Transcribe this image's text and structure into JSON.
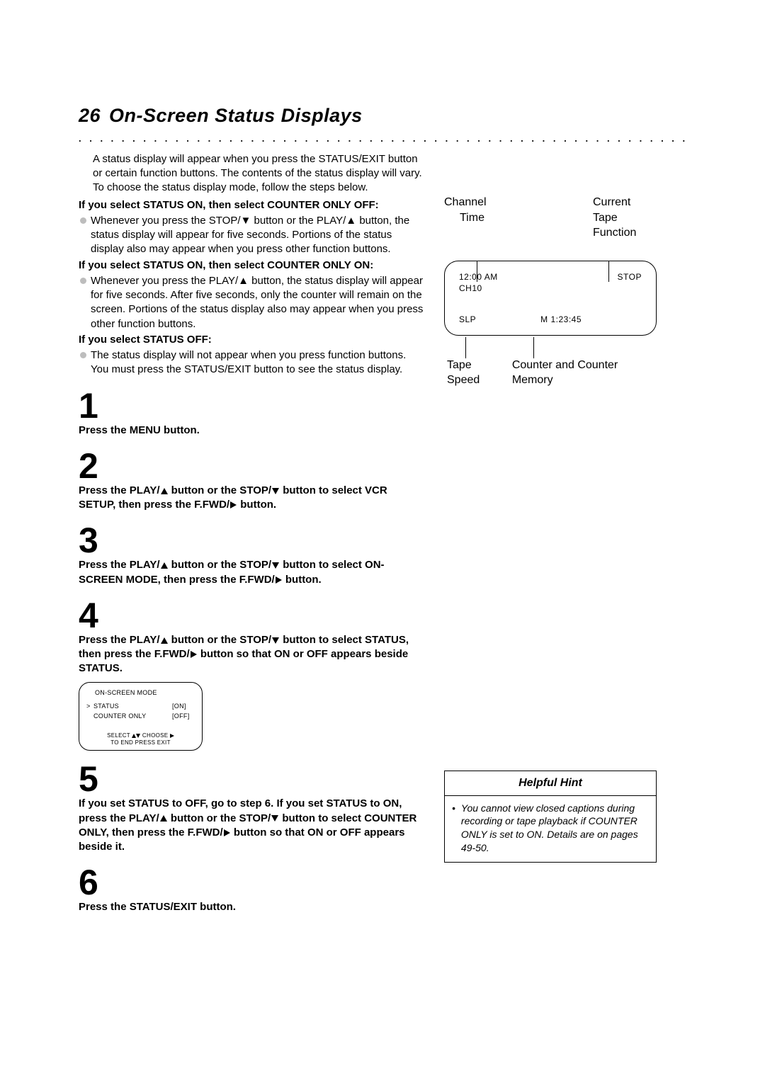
{
  "page": {
    "number": "26",
    "title": "On-Screen Status Displays",
    "dots": ". . . . . . . . . . . . . . . . . . . . . . . . . . . . . . . . . . . . . . . . . . . . . . . . . . . . . . . . . . . . . . . . . . . . . . . . . . . . . . . . . . . . . . . . . . . . . . . . . . . . . . . . ."
  },
  "intro": "A status display will appear when you press the STATUS/EXIT button or certain function buttons. The contents of the status display will vary. To choose the status display mode, follow the steps below.",
  "conditions": [
    {
      "heading": "If you select STATUS ON, then select COUNTER ONLY OFF:",
      "body": "Whenever you press the STOP/▼ button or the PLAY/▲ button, the status display will appear for five seconds. Portions of the status display also may appear when you press other function buttons."
    },
    {
      "heading": "If you select STATUS ON, then select COUNTER ONLY ON:",
      "body": "Whenever you press the PLAY/▲ button, the status display will appear for five seconds. After five seconds, only the counter will remain on the screen. Portions of the status display also may appear when you press other function buttons."
    },
    {
      "heading": "If you select STATUS OFF:",
      "body": "The status display will not appear when you press function buttons. You must press the STATUS/EXIT button to see the status display."
    }
  ],
  "steps": {
    "s1": "Press the MENU button.",
    "s2a": "Press the PLAY/",
    "s2b": " button or the STOP/",
    "s2c": " button to select VCR SETUP, then press the F.FWD/",
    "s2d": " button.",
    "s3a": "Press the PLAY/",
    "s3b": " button or the STOP/",
    "s3c": " button to select ON-SCREEN MODE, then press the F.FWD/",
    "s3d": " button.",
    "s4a": "Press the PLAY/",
    "s4b": " button or the STOP/",
    "s4c": " button to select STATUS, then press the F.FWD/",
    "s4d": " button so that ON or OFF appears beside STATUS.",
    "s5a": "If you set STATUS to OFF, go to step 6. If you set STATUS to ON, press the PLAY/",
    "s5b": " button or the STOP/",
    "s5c": " button to select COUNTER ONLY, then press the F.FWD/",
    "s5d": " button so that ON or OFF appears beside it.",
    "s6": "Press the STATUS/EXIT button"
  },
  "osd": {
    "title": "ON-SCREEN MODE",
    "row1_ind": ">",
    "row1_label": "STATUS",
    "row1_val": "[ON]",
    "row2_label": "COUNTER ONLY",
    "row2_val": "[OFF]",
    "foot1": "SELECT ▲▼ CHOOSE ▶",
    "foot2": "TO END PRESS EXIT"
  },
  "diagram": {
    "label_channel": "Channel",
    "label_time": "Time",
    "label_current_tape_function": "Current Tape Function",
    "time": "12:00 AM",
    "channel": "CH10",
    "function": "STOP",
    "speed": "SLP",
    "counter": "M  1:23:45",
    "label_tape_speed": "Tape Speed",
    "label_counter": "Counter and Counter Memory"
  },
  "hint": {
    "title": "Helpful Hint",
    "body": "You cannot view closed captions during recording or tape playback if COUNTER ONLY is set to ON. Details are on pages 49-50."
  }
}
